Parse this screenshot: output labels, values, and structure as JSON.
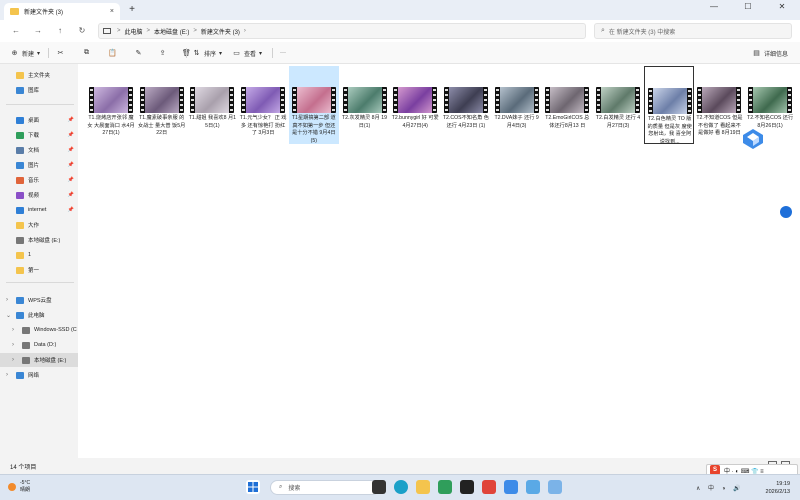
{
  "tab": {
    "title": "新建文件夹 (3)",
    "close": "×"
  },
  "newtab": "+",
  "window": {
    "min": "—",
    "max": "☐",
    "close": "✕"
  },
  "nav": {
    "back": "←",
    "forward": "→",
    "up": "↑",
    "refresh": "↻",
    "more": "›"
  },
  "breadcrumbs": [
    "此电脑",
    "本地磁盘 (E:)",
    "新建文件夹 (3)"
  ],
  "breadcrumb_sep": ">",
  "search": {
    "placeholder": "在 新建文件夹 (3) 中搜索",
    "icon": "search-icon"
  },
  "toolbar": {
    "new_label": "新建",
    "sort_label": "排序",
    "view_label": "查看",
    "more_label": "···",
    "details_label": "详细信息"
  },
  "sidebar": {
    "items": [
      {
        "label": "主文件夹",
        "icon": "home-icon",
        "color": "#f4c44d"
      },
      {
        "label": "图库",
        "icon": "gallery-icon",
        "color": "#3a86d4"
      },
      {
        "label": "桌面",
        "icon": "desktop-icon",
        "color": "#2f7fd6",
        "pinned": true
      },
      {
        "label": "下载",
        "icon": "download-icon",
        "color": "#2f9e5b",
        "pinned": true
      },
      {
        "label": "文档",
        "icon": "document-icon",
        "color": "#5a7da8",
        "pinned": true
      },
      {
        "label": "图片",
        "icon": "pictures-icon",
        "color": "#3a86d4",
        "pinned": true
      },
      {
        "label": "音乐",
        "icon": "music-icon",
        "color": "#e0643a",
        "pinned": true
      },
      {
        "label": "视频",
        "icon": "video-icon",
        "color": "#8a4fc7",
        "pinned": true
      },
      {
        "label": "internet",
        "icon": "folder-icon",
        "color": "#2f7fd6",
        "pinned": true
      },
      {
        "label": "大作",
        "icon": "folder-icon",
        "color": "#f4c44d"
      },
      {
        "label": "本地磁盘 (E:)",
        "icon": "drive-icon",
        "color": "#777"
      },
      {
        "label": "1",
        "icon": "folder-icon",
        "color": "#f4c44d"
      },
      {
        "label": "第一",
        "icon": "folder-icon",
        "color": "#f4c44d"
      },
      {
        "label": "WPS云盘",
        "icon": "cloud-icon",
        "color": "#3a86d4",
        "expandable": true
      },
      {
        "label": "此电脑",
        "icon": "pc-icon",
        "color": "#3a86d4",
        "expanded": true
      },
      {
        "label": "Windows-SSD (C",
        "icon": "drive-icon",
        "color": "#777",
        "indent": true
      },
      {
        "label": "Data (D:)",
        "icon": "drive-icon",
        "color": "#777",
        "indent": true
      },
      {
        "label": "本地磁盘 (E:)",
        "icon": "drive-icon",
        "color": "#777",
        "indent": true,
        "selected": true
      },
      {
        "label": "网络",
        "icon": "network-icon",
        "color": "#3a86d4",
        "expandable": true
      }
    ]
  },
  "files": [
    {
      "name": "T1.烧烤店开张邻 魔女  大晨面消口 水4月27日(1)",
      "c1": "#8b6ea8",
      "c2": "#d8c4e8"
    },
    {
      "name": "T1.魔素破事亲服 的女战士 量大普 饭5月22日",
      "c1": "#6c5a7a",
      "c2": "#c7b7cf"
    },
    {
      "name": "T1.甜姐 我喜欢8 月15日(1)",
      "c1": "#a9a0ac",
      "c2": "#e7e1ea"
    },
    {
      "name": "T1.元气少女？ 正 戏多 还有惊艳打 扮红了 3月3日",
      "c1": "#7f5bb4",
      "c2": "#d0b7ef"
    },
    {
      "name": "T1星期搞第二部 道真不如第一步 但还是十分不错 9月4日(5)",
      "c1": "#c46f8e",
      "c2": "#f1c9da"
    },
    {
      "name": "T2.灰发精灵 8月 19日(1)",
      "c1": "#4c7c6c",
      "c2": "#b9d8cb"
    },
    {
      "name": "T2.bunnygirl 好 可爱4月27日(4)",
      "c1": "#7a3fa0",
      "c2": "#e2a7d6"
    },
    {
      "name": "T2.COS不知名角 色 还行 4月23日 (1)",
      "c1": "#3e3e52",
      "c2": "#9a9ab8"
    },
    {
      "name": "T2.DVA妹子 还行 9月4日(3)",
      "c1": "#5a6b7a",
      "c2": "#c3cfda"
    },
    {
      "name": "T2.EmoGirlCOS 总体还行8月13 日",
      "c1": "#6e6670",
      "c2": "#d4cbd4"
    },
    {
      "name": "T2.白发精灵 还行 4月27日(3)",
      "c1": "#5f7a6a",
      "c2": "#cfe0d4"
    },
    {
      "name": "T2.白色精灵 TO 版的质量 但是灰 度使您射出，我 喜全阿说找到...",
      "c1": "#6d7fa8",
      "c2": "#d9e2f4"
    },
    {
      "name": "T2.不知道COS 但是不也做了 看起来不是做好 看 8月19日",
      "c1": "#5b4a5c",
      "c2": "#c9b8c9"
    },
    {
      "name": "T2.不知名COS 还行 8月26日(1)",
      "c1": "#3f6a4e",
      "c2": "#b6d6bf"
    }
  ],
  "selected_file_index": 4,
  "focused_file_index": 11,
  "status": {
    "count": "14 个项目"
  },
  "taskbar": {
    "weather_temp": "-5°C",
    "weather_desc": "晴朗",
    "search_placeholder": "搜索",
    "time": "19:19",
    "date": "2026/2/13",
    "tray_text": "∧ 中 ◑ 🔊"
  },
  "ime": {
    "logo": "S",
    "text": "中 · ◐ ⌨ 👕 ≡"
  }
}
